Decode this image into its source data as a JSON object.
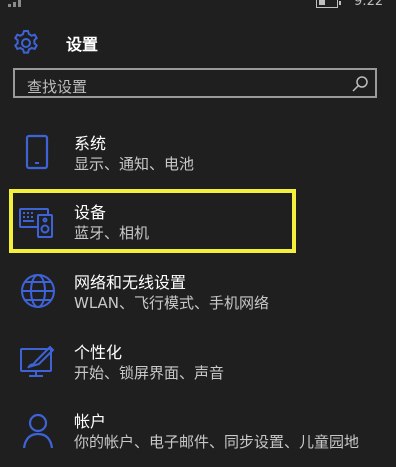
{
  "status_bar": {
    "time": "9:22"
  },
  "header": {
    "title": "设置",
    "icon": "gear-icon"
  },
  "search": {
    "placeholder": "查找设置",
    "icon": "search-icon"
  },
  "colors": {
    "background": "#1f1f1f",
    "accent": "#3e63d8",
    "highlight": "#f3f03b",
    "text": "#ffffff",
    "subtext": "#c8c8c8"
  },
  "settings": {
    "items": [
      {
        "label": "系统",
        "desc": "显示、通知、电池",
        "icon": "phone-icon"
      },
      {
        "label": "设备",
        "desc": "蓝牙、相机",
        "icon": "devices-icon"
      },
      {
        "label": "网络和无线设置",
        "desc": "WLAN、飞行模式、手机网络",
        "icon": "globe-icon"
      },
      {
        "label": "个性化",
        "desc": "开始、锁屏界面、声音",
        "icon": "personalization-icon"
      },
      {
        "label": "帐户",
        "desc": "你的帐户、电子邮件、同步设置、儿童园地",
        "icon": "person-icon"
      }
    ]
  }
}
